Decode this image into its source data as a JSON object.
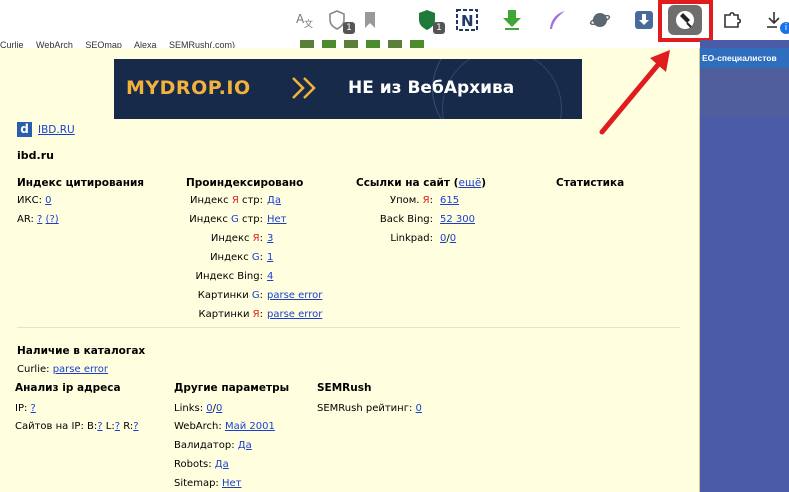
{
  "toolbar": {
    "badges": {
      "shield_count": "1",
      "ublock_count": "1",
      "download_badge": "i"
    },
    "icons": [
      "translate-icon",
      "shield-extension-icon",
      "bookmark-icon",
      "ublock-icon",
      "n-extension-icon",
      "download-arrow-icon",
      "feather-icon",
      "planet-icon",
      "download-box-icon",
      "rds-bar-icon",
      "puzzle-icon",
      "downloads-icon"
    ]
  },
  "bookmarks": [
    "Curlie",
    "WebArch",
    "SEOmap",
    "Alexa",
    "SEMRush(.com)"
  ],
  "right_page": {
    "strip_text": "EO-специалистов"
  },
  "banner": {
    "brand": "MYDROP.IO",
    "tagline": "НЕ из ВебАрхива"
  },
  "site": {
    "icon_letter": "d",
    "link": "IBD.RU",
    "domain": "ibd.ru"
  },
  "citation": {
    "title": "Индекс цитирования",
    "iks_label": "ИКС:",
    "iks_value": "0",
    "ar_label": "AR:",
    "ar_value": "?",
    "ar_extra": "(?)"
  },
  "indexed": {
    "title": "Проиндексировано",
    "rows": [
      {
        "pre": "Индекс ",
        "letter": "Я",
        "letter_color": "red",
        "post": " стр:",
        "value": "Да"
      },
      {
        "pre": "Индекс ",
        "letter": "G",
        "letter_color": "blue",
        "post": " стр:",
        "value": "Нет"
      },
      {
        "pre": "Индекс ",
        "letter": "Я",
        "letter_color": "red",
        "post": ":",
        "value": "3"
      },
      {
        "pre": "Индекс ",
        "letter": "G",
        "letter_color": "blue",
        "post": ":",
        "value": "1"
      },
      {
        "pre": "Индекс Bing",
        "letter": "",
        "letter_color": "",
        "post": ":",
        "value": "4"
      },
      {
        "pre": "Картинки ",
        "letter": "G",
        "letter_color": "blue",
        "post": ":",
        "value": "parse error"
      },
      {
        "pre": "Картинки ",
        "letter": "Я",
        "letter_color": "red",
        "post": ":",
        "value": "parse error"
      }
    ]
  },
  "links": {
    "title": "Ссылки на сайт",
    "title_link": "ещё",
    "rows": [
      {
        "pre": "Упом. ",
        "letter": "Я",
        "post": ":",
        "value": "615"
      },
      {
        "pre": "Back Bing",
        "letter": "",
        "post": ":",
        "value": "52 300"
      },
      {
        "pre": "Linkpad",
        "letter": "",
        "post": ":",
        "value": "0",
        "value2": "0"
      }
    ]
  },
  "statistics": {
    "title": "Статистика"
  },
  "catalogs": {
    "title": "Наличие в каталогах",
    "curlie_label": "Curlie:",
    "curlie_value": "parse error"
  },
  "ip": {
    "title": "Анализ ip адреса",
    "ip_label": "IP:",
    "ip_value": "?",
    "sites_label": "Сайтов на IP:",
    "b_label": "B:",
    "b_value": "?",
    "l_label": "L:",
    "l_value": "?",
    "r_label": "R:",
    "r_value": "?"
  },
  "other": {
    "title": "Другие параметры",
    "links_label": "Links:",
    "links_v1": "0",
    "links_v2": "0",
    "webarch_label": "WebArch:",
    "webarch_value": "Май 2001",
    "validator_label": "Валидатор:",
    "validator_value": "Да",
    "robots_label": "Robots:",
    "robots_value": "Да",
    "sitemap_label": "Sitemap:",
    "sitemap_value": "Нет"
  },
  "semrush": {
    "title": "SEMRush",
    "label": "SEMRush рейтинг:",
    "value": "0"
  },
  "colors": {
    "popup_bg": "#ffffe0",
    "link": "#1a3fcf",
    "highlight": "#e11c1c",
    "yandex_red": "#e02020"
  }
}
